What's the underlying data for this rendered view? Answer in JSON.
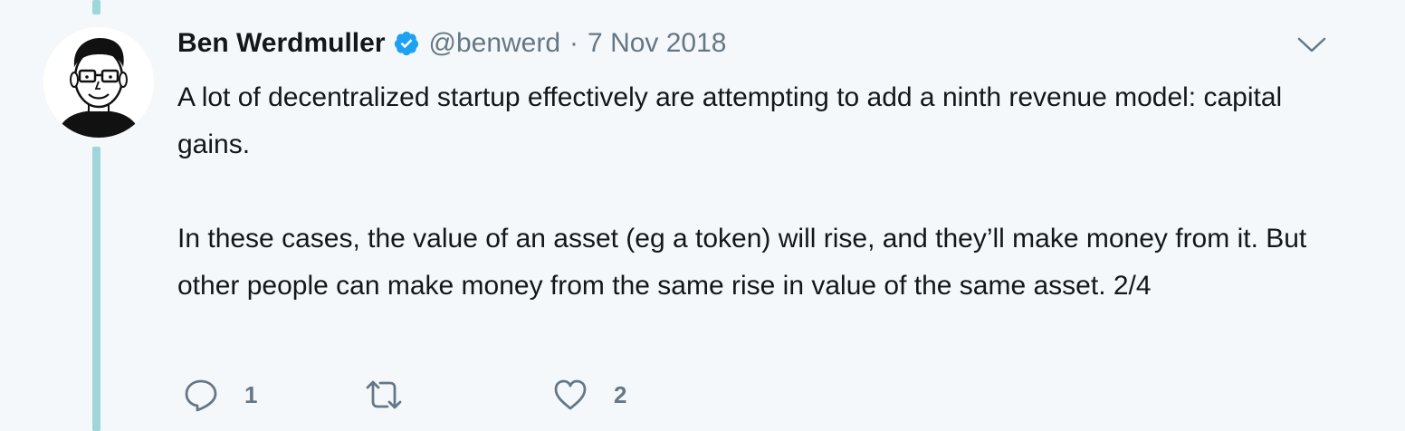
{
  "tweet": {
    "author_name": "Ben Werdmuller",
    "handle": "@benwerd",
    "separator": "·",
    "date": "7 Nov 2018",
    "paragraphs": [
      "A lot of decentralized startup effectively are attempting to add a ninth revenue model: capital gains.",
      "In these cases, the value of an asset (eg a token) will rise, and they’ll make money from it. But other people can make money from the same rise in value of the same asset. 2/4"
    ],
    "verified": true
  },
  "actions": {
    "reply_count": "1",
    "retweet_count": "",
    "like_count": "2"
  },
  "icons": {
    "reply": "reply-icon",
    "retweet": "retweet-icon",
    "like": "heart-icon",
    "menu": "chevron-down-icon",
    "verified": "verified-badge-icon"
  },
  "colors": {
    "background": "#f5f8fa",
    "thread_line": "#9fd6da",
    "verified": "#1da1f2",
    "secondary_text": "#657786"
  }
}
